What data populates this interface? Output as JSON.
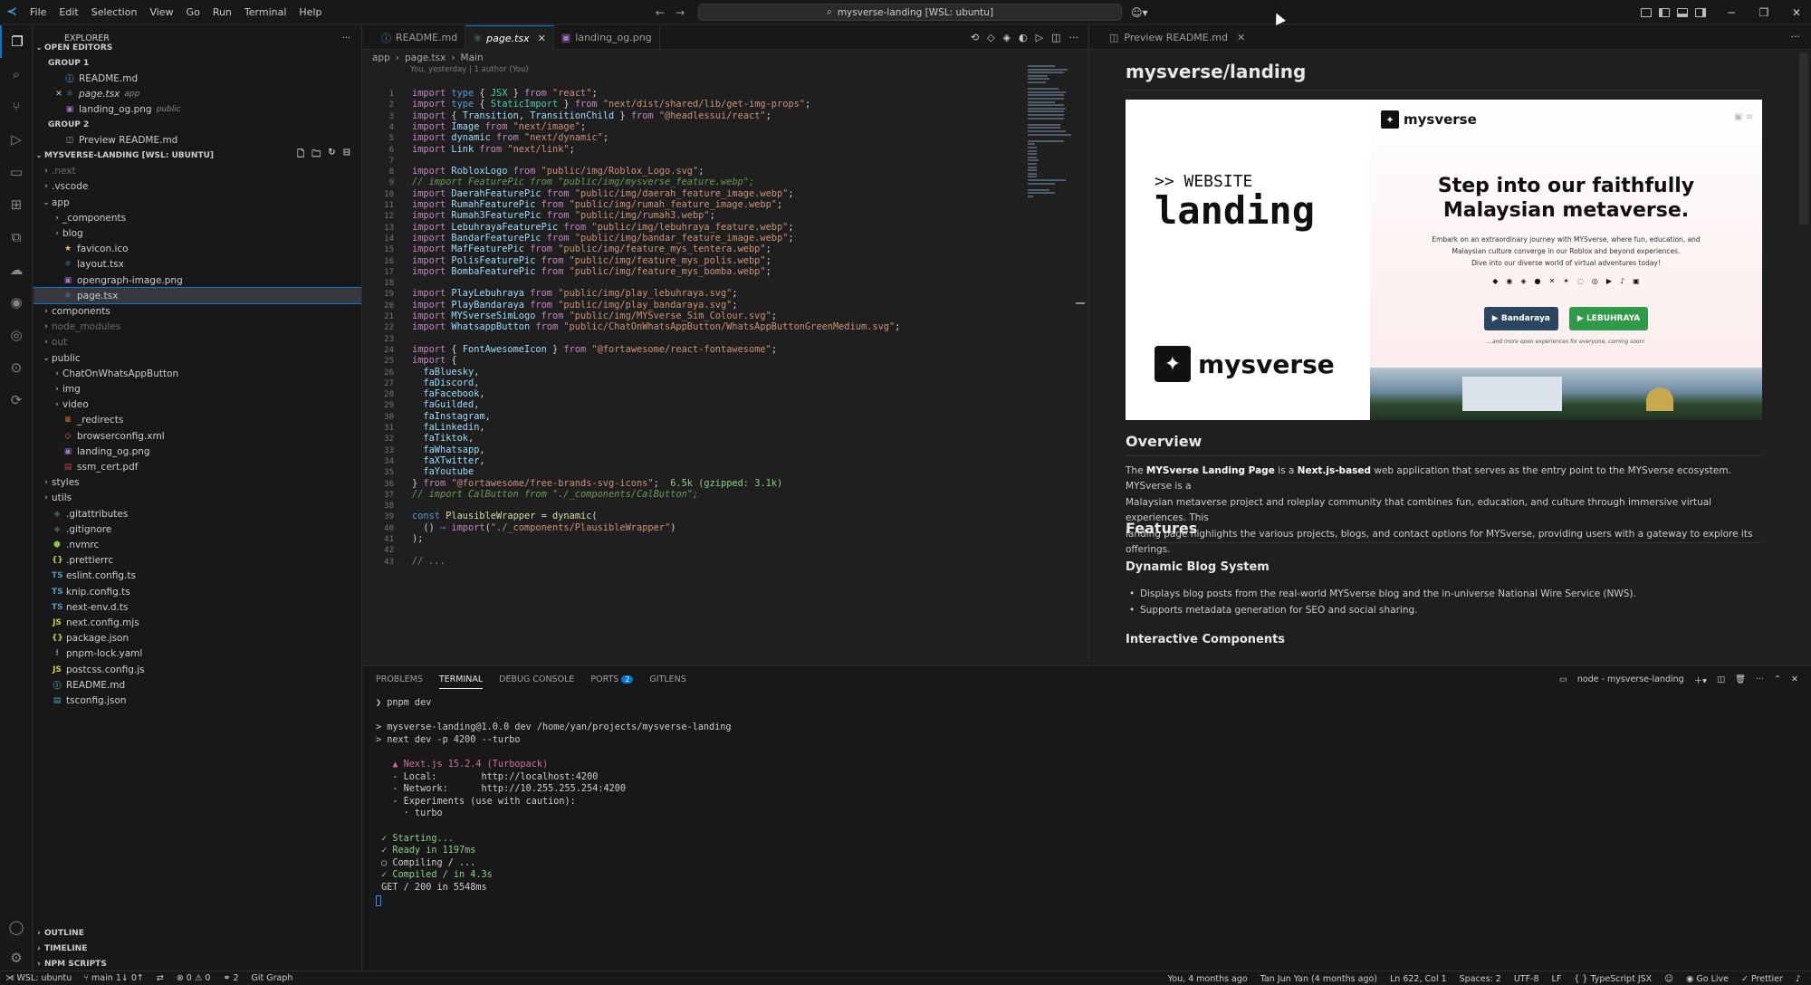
{
  "titlebar": {
    "menus": [
      "File",
      "Edit",
      "Selection",
      "View",
      "Go",
      "Run",
      "Terminal",
      "Help"
    ],
    "search_text": "mysverse-landing [WSL: ubuntu]",
    "copilot_caret": "▾"
  },
  "sidebar": {
    "title": "EXPLORER",
    "open_editors": "OPEN EDITORS",
    "group1": "GROUP 1",
    "group2": "GROUP 2",
    "open_files": [
      {
        "name": "README.md",
        "desc": ""
      },
      {
        "name": "page.tsx",
        "desc": "app"
      },
      {
        "name": "landing_og.png",
        "desc": "public"
      },
      {
        "name": "Preview README.md",
        "desc": ""
      }
    ],
    "workspace": "MYSVERSE-LANDING [WSL: UBUNTU]",
    "tree": [
      {
        "name": ".next",
        "dim": true,
        "folder": true,
        "open": false,
        "indent": 0
      },
      {
        "name": ".vscode",
        "folder": true,
        "open": false,
        "indent": 0
      },
      {
        "name": "app",
        "folder": true,
        "open": true,
        "indent": 0
      },
      {
        "name": "_components",
        "folder": true,
        "open": false,
        "indent": 1
      },
      {
        "name": "blog",
        "folder": true,
        "open": false,
        "indent": 1
      },
      {
        "name": "favicon.ico",
        "icon": "★",
        "color": "#e2c08d",
        "indent": 1
      },
      {
        "name": "layout.tsx",
        "icon": "⚛",
        "color": "#519aba",
        "indent": 1
      },
      {
        "name": "opengraph-image.png",
        "icon": "▣",
        "color": "#a074c4",
        "indent": 1
      },
      {
        "name": "page.tsx",
        "icon": "⚛",
        "color": "#519aba",
        "indent": 1,
        "selected": true
      },
      {
        "name": "components",
        "folder": true,
        "open": false,
        "indent": 0
      },
      {
        "name": "node_modules",
        "dim": true,
        "folder": true,
        "open": false,
        "indent": 0
      },
      {
        "name": "out",
        "dim": true,
        "folder": true,
        "open": false,
        "indent": 0
      },
      {
        "name": "public",
        "folder": true,
        "open": true,
        "indent": 0
      },
      {
        "name": "ChatOnWhatsAppButton",
        "folder": true,
        "open": false,
        "indent": 1
      },
      {
        "name": "img",
        "folder": true,
        "open": false,
        "indent": 1
      },
      {
        "name": "video",
        "folder": true,
        "open": false,
        "indent": 1
      },
      {
        "name": "_redirects",
        "icon": "≡",
        "color": "#e37933",
        "indent": 1
      },
      {
        "name": "browserconfig.xml",
        "icon": "◇",
        "color": "#e37933",
        "indent": 1
      },
      {
        "name": "landing_og.png",
        "icon": "▣",
        "color": "#a074c4",
        "indent": 1
      },
      {
        "name": "ssm_cert.pdf",
        "icon": "▤",
        "color": "#cc3e44",
        "indent": 1
      },
      {
        "name": "styles",
        "folder": true,
        "open": false,
        "indent": 0
      },
      {
        "name": "utils",
        "folder": true,
        "open": false,
        "indent": 0
      },
      {
        "name": ".gitattributes",
        "icon": "◆",
        "color": "#41535b",
        "indent": 0
      },
      {
        "name": ".gitignore",
        "icon": "◆",
        "color": "#41535b",
        "indent": 0
      },
      {
        "name": ".nvmrc",
        "icon": "⬢",
        "color": "#8bc34a",
        "indent": 0
      },
      {
        "name": ".prettierrc",
        "icon": "{}",
        "color": "#cbcb41",
        "indent": 0
      },
      {
        "name": "eslint.config.ts",
        "icon": "TS",
        "color": "#519aba",
        "indent": 0
      },
      {
        "name": "knip.config.ts",
        "icon": "TS",
        "color": "#519aba",
        "indent": 0
      },
      {
        "name": "next-env.d.ts",
        "icon": "TS",
        "color": "#519aba",
        "indent": 0
      },
      {
        "name": "next.config.mjs",
        "icon": "JS",
        "color": "#cbcb41",
        "indent": 0
      },
      {
        "name": "package.json",
        "icon": "{}",
        "color": "#cbcb41",
        "indent": 0
      },
      {
        "name": "pnpm-lock.yaml",
        "icon": "!",
        "color": "#a074c4",
        "indent": 0
      },
      {
        "name": "postcss.config.js",
        "icon": "JS",
        "color": "#cbcb41",
        "indent": 0
      },
      {
        "name": "README.md",
        "icon": "ⓘ",
        "color": "#519aba",
        "indent": 0
      },
      {
        "name": "tsconfig.json",
        "icon": "▤",
        "color": "#519aba",
        "indent": 0
      }
    ],
    "bottom_sections": [
      "OUTLINE",
      "TIMELINE",
      "NPM SCRIPTS"
    ]
  },
  "editor": {
    "tabs": [
      {
        "label": "README.md",
        "icon": "ⓘ",
        "active": false
      },
      {
        "label": "page.tsx",
        "icon": "⚛",
        "active": true
      },
      {
        "label": "landing_og.png",
        "icon": "▣",
        "active": false
      }
    ],
    "breadcrumb": [
      "app",
      "page.tsx",
      "Main"
    ],
    "blame": "You, yesterday | 1 author (You)",
    "lines": [
      [
        [
          "kw",
          "import "
        ],
        [
          "ty",
          "type "
        ],
        [
          "pl",
          "{ "
        ],
        [
          "cls",
          "JSX"
        ],
        [
          "pl",
          " } "
        ],
        [
          "kw",
          "from "
        ],
        [
          "st",
          "\"react\""
        ],
        [
          "pl",
          ";"
        ]
      ],
      [
        [
          "kw",
          "import "
        ],
        [
          "ty",
          "type "
        ],
        [
          "pl",
          "{ "
        ],
        [
          "cls",
          "StaticImport"
        ],
        [
          "pl",
          " } "
        ],
        [
          "kw",
          "from "
        ],
        [
          "st",
          "\"next/dist/shared/lib/get-img-props\""
        ],
        [
          "pl",
          ";"
        ]
      ],
      [
        [
          "kw",
          "import "
        ],
        [
          "pl",
          "{ "
        ],
        [
          "id",
          "Transition"
        ],
        [
          "pl",
          ", "
        ],
        [
          "id",
          "TransitionChild"
        ],
        [
          "pl",
          " } "
        ],
        [
          "kw",
          "from "
        ],
        [
          "st",
          "\"@headlessui/react\""
        ],
        [
          "pl",
          ";"
        ]
      ],
      [
        [
          "kw",
          "import "
        ],
        [
          "id",
          "Image "
        ],
        [
          "kw",
          "from "
        ],
        [
          "st",
          "\"next/image\""
        ],
        [
          "pl",
          ";"
        ]
      ],
      [
        [
          "kw",
          "import "
        ],
        [
          "id",
          "dynamic "
        ],
        [
          "kw",
          "from "
        ],
        [
          "st",
          "\"next/dynamic\""
        ],
        [
          "pl",
          ";"
        ]
      ],
      [
        [
          "kw",
          "import "
        ],
        [
          "id",
          "Link "
        ],
        [
          "kw",
          "from "
        ],
        [
          "st",
          "\"next/link\""
        ],
        [
          "pl",
          ";"
        ]
      ],
      [],
      [
        [
          "kw",
          "import "
        ],
        [
          "id",
          "RobloxLogo "
        ],
        [
          "kw",
          "from "
        ],
        [
          "st",
          "\"public/img/Roblox_Logo.svg\""
        ],
        [
          "pl",
          ";"
        ]
      ],
      [
        [
          "cm",
          "// import FeaturePic from \"public/img/mysverse_feature.webp\";"
        ]
      ],
      [
        [
          "kw",
          "import "
        ],
        [
          "id",
          "DaerahFeaturePic "
        ],
        [
          "kw",
          "from "
        ],
        [
          "st",
          "\"public/img/daerah_feature_image.webp\""
        ],
        [
          "pl",
          ";"
        ]
      ],
      [
        [
          "kw",
          "import "
        ],
        [
          "id",
          "RumahFeaturePic "
        ],
        [
          "kw",
          "from "
        ],
        [
          "st",
          "\"public/img/rumah_feature_image.webp\""
        ],
        [
          "pl",
          ";"
        ]
      ],
      [
        [
          "kw",
          "import "
        ],
        [
          "id",
          "Rumah3FeaturePic "
        ],
        [
          "kw",
          "from "
        ],
        [
          "st",
          "\"public/img/rumah3.webp\""
        ],
        [
          "pl",
          ";"
        ]
      ],
      [
        [
          "kw",
          "import "
        ],
        [
          "id",
          "LebuhrayaFeaturePic "
        ],
        [
          "kw",
          "from "
        ],
        [
          "st",
          "\"public/img/lebuhraya_feature.webp\""
        ],
        [
          "pl",
          ";"
        ]
      ],
      [
        [
          "kw",
          "import "
        ],
        [
          "id",
          "BandarFeaturePic "
        ],
        [
          "kw",
          "from "
        ],
        [
          "st",
          "\"public/img/bandar_feature_image.webp\""
        ],
        [
          "pl",
          ";"
        ]
      ],
      [
        [
          "kw",
          "import "
        ],
        [
          "id",
          "MafFeaturePic "
        ],
        [
          "kw",
          "from "
        ],
        [
          "st",
          "\"public/img/feature_mys_tentera.webp\""
        ],
        [
          "pl",
          ";"
        ]
      ],
      [
        [
          "kw",
          "import "
        ],
        [
          "id",
          "PolisFeaturePic "
        ],
        [
          "kw",
          "from "
        ],
        [
          "st",
          "\"public/img/feature_mys_polis.webp\""
        ],
        [
          "pl",
          ";"
        ]
      ],
      [
        [
          "kw",
          "import "
        ],
        [
          "id",
          "BombaFeaturePic "
        ],
        [
          "kw",
          "from "
        ],
        [
          "st",
          "\"public/img/feature_mys_bomba.webp\""
        ],
        [
          "pl",
          ";"
        ]
      ],
      [],
      [
        [
          "kw",
          "import "
        ],
        [
          "id",
          "PlayLebuhraya "
        ],
        [
          "kw",
          "from "
        ],
        [
          "st",
          "\"public/img/play_lebuhraya.svg\""
        ],
        [
          "pl",
          ";"
        ]
      ],
      [
        [
          "kw",
          "import "
        ],
        [
          "id",
          "PlayBandaraya "
        ],
        [
          "kw",
          "from "
        ],
        [
          "st",
          "\"public/img/play_bandaraya.svg\""
        ],
        [
          "pl",
          ";"
        ]
      ],
      [
        [
          "kw",
          "import "
        ],
        [
          "id",
          "MYSverseSimLogo "
        ],
        [
          "kw",
          "from "
        ],
        [
          "st",
          "\"public/img/MYSverse_Sim_Colour.svg\""
        ],
        [
          "pl",
          ";"
        ]
      ],
      [
        [
          "kw",
          "import "
        ],
        [
          "id",
          "WhatsappButton "
        ],
        [
          "kw",
          "from "
        ],
        [
          "st",
          "\"public/ChatOnWhatsAppButton/WhatsAppButtonGreenMedium.svg\""
        ],
        [
          "pl",
          ";"
        ]
      ],
      [],
      [
        [
          "kw",
          "import "
        ],
        [
          "pl",
          "{ "
        ],
        [
          "id",
          "FontAwesomeIcon"
        ],
        [
          "pl",
          " } "
        ],
        [
          "kw",
          "from "
        ],
        [
          "st",
          "\"@fortawesome/react-fontawesome\""
        ],
        [
          "pl",
          ";"
        ]
      ],
      [
        [
          "kw",
          "import "
        ],
        [
          "pl",
          "{"
        ]
      ],
      [
        [
          "pl",
          "  "
        ],
        [
          "id",
          "faBluesky"
        ],
        [
          "pl",
          ","
        ]
      ],
      [
        [
          "pl",
          "  "
        ],
        [
          "id",
          "faDiscord"
        ],
        [
          "pl",
          ","
        ]
      ],
      [
        [
          "pl",
          "  "
        ],
        [
          "id",
          "faFacebook"
        ],
        [
          "pl",
          ","
        ]
      ],
      [
        [
          "pl",
          "  "
        ],
        [
          "id",
          "faGuilded"
        ],
        [
          "pl",
          ","
        ]
      ],
      [
        [
          "pl",
          "  "
        ],
        [
          "id",
          "faInstagram"
        ],
        [
          "pl",
          ","
        ]
      ],
      [
        [
          "pl",
          "  "
        ],
        [
          "id",
          "faLinkedin"
        ],
        [
          "pl",
          ","
        ]
      ],
      [
        [
          "pl",
          "  "
        ],
        [
          "id",
          "faTiktok"
        ],
        [
          "pl",
          ","
        ]
      ],
      [
        [
          "pl",
          "  "
        ],
        [
          "id",
          "faWhatsapp"
        ],
        [
          "pl",
          ","
        ]
      ],
      [
        [
          "pl",
          "  "
        ],
        [
          "id",
          "faXTwitter"
        ],
        [
          "pl",
          ","
        ]
      ],
      [
        [
          "pl",
          "  "
        ],
        [
          "id",
          "faYoutube"
        ]
      ],
      [
        [
          "pl",
          "} "
        ],
        [
          "kw",
          "from "
        ],
        [
          "st",
          "\"@fortawesome/free-brands-svg-icons\""
        ],
        [
          "pl",
          ";  "
        ],
        [
          "inl",
          "6.5k (gzipped: 3.1k)"
        ]
      ],
      [
        [
          "cm",
          "// import CalButton from \"./_components/CalButton\";"
        ]
      ],
      [],
      [
        [
          "ty",
          "const "
        ],
        [
          "fn",
          "PlausibleWrapper"
        ],
        [
          "pl",
          " = "
        ],
        [
          "fn",
          "dynamic"
        ],
        [
          "pl",
          "("
        ]
      ],
      [
        [
          "pl",
          "  () "
        ],
        [
          "ty",
          "⇒ "
        ],
        [
          "kw",
          "import"
        ],
        [
          "pl",
          "("
        ],
        [
          "st",
          "\"./_components/PlausibleWrapper\""
        ],
        [
          "pl",
          ")"
        ]
      ],
      [
        [
          "pl",
          ");"
        ]
      ],
      [],
      [
        [
          "cm",
          "// ..."
        ]
      ]
    ]
  },
  "preview": {
    "tab_label": "Preview README.md",
    "h1": "mysverse/landing",
    "banner": {
      "kicker": ">> WEBSITE",
      "title": "landing",
      "logo_text": "mysverse",
      "heading_line1": "Step into our faithfully",
      "heading_line2": "Malaysian metaverse.",
      "sub1": "Embark on an extraordinary journey with MYSverse, where fun, education, and",
      "sub2": "Malaysian culture converge in our Roblox and beyond experiences.",
      "sub3": "Dive into our diverse world of virtual adventures today!",
      "btn1": "▶ Bandaraya",
      "btn2": "▶ LEBUHRAYA",
      "more": "...and more open experiences for everyone, coming soon!"
    },
    "overview_heading": "Overview",
    "overview_l1": "The MYSverse Landing Page is a Next.js-based web application that serves as the entry point to the MYSverse ecosystem. MYSverse is a",
    "overview_l2": "Malaysian metaverse project and roleplay community that combines fun, education, and culture through immersive virtual experiences. This",
    "overview_l3": "landing page highlights the various projects, blogs, and contact options for MYSverse, providing users with a gateway to explore its offerings.",
    "features_heading": "Features",
    "blog_heading": "Dynamic Blog System",
    "blog_items": [
      "Displays blog posts from the real-world MYSverse blog and the in-universe National Wire Service (NWS).",
      "Supports metadata generation for SEO and social sharing."
    ],
    "next_heading": "Interactive Components"
  },
  "panel": {
    "tabs": [
      "PROBLEMS",
      "TERMINAL",
      "DEBUG CONSOLE",
      "PORTS",
      "GITLENS"
    ],
    "ports_count": "2",
    "terminal_name": "node - mysverse-landing",
    "terminal_lines": [
      {
        "t": "❯ pnpm dev",
        "c": ""
      },
      {
        "t": "",
        "c": ""
      },
      {
        "t": "> mysverse-landing@1.0.0 dev /home/yan/projects/mysverse-landing",
        "c": ""
      },
      {
        "t": "> next dev -p 4200 --turbo",
        "c": ""
      },
      {
        "t": "",
        "c": ""
      },
      {
        "t": "   ▲ Next.js 15.2.4 (Turbopack)",
        "c": "tm"
      },
      {
        "t": "   - Local:        http://localhost:4200",
        "c": ""
      },
      {
        "t": "   - Network:      http://10.255.255.254:4200",
        "c": ""
      },
      {
        "t": "   - Experiments (use with caution):",
        "c": ""
      },
      {
        "t": "     · turbo",
        "c": ""
      },
      {
        "t": "",
        "c": ""
      },
      {
        "t": " ✓ Starting...",
        "c": "tg"
      },
      {
        "t": " ✓ Ready in 1197ms",
        "c": "tg"
      },
      {
        "t": " ○ Compiling / ...",
        "c": ""
      },
      {
        "t": " ✓ Compiled / in 4.3s",
        "c": "tg"
      },
      {
        "t": " GET / 200 in 5548ms",
        "c": ""
      }
    ]
  },
  "statusbar": {
    "remote": "WSL: ubuntu",
    "branch": "main",
    "sync": "1↓ 0↑",
    "problems": "⊗ 0 ⚠ 0",
    "ports": "2",
    "git_graph": "Git Graph",
    "blame_self": "You, 4 months ago",
    "blame_other": "Tan Jun Yan (4 months ago)",
    "position": "Ln 622, Col 1",
    "spaces": "Spaces: 2",
    "encoding": "UTF-8",
    "eol": "LF",
    "language": "TypeScript JSX",
    "golive": "Go Live",
    "prettier": "Prettier"
  },
  "colors": {
    "accent": "#0078d4",
    "string": "#ce9178",
    "keyword": "#c586c0",
    "ok": "#89d185"
  }
}
